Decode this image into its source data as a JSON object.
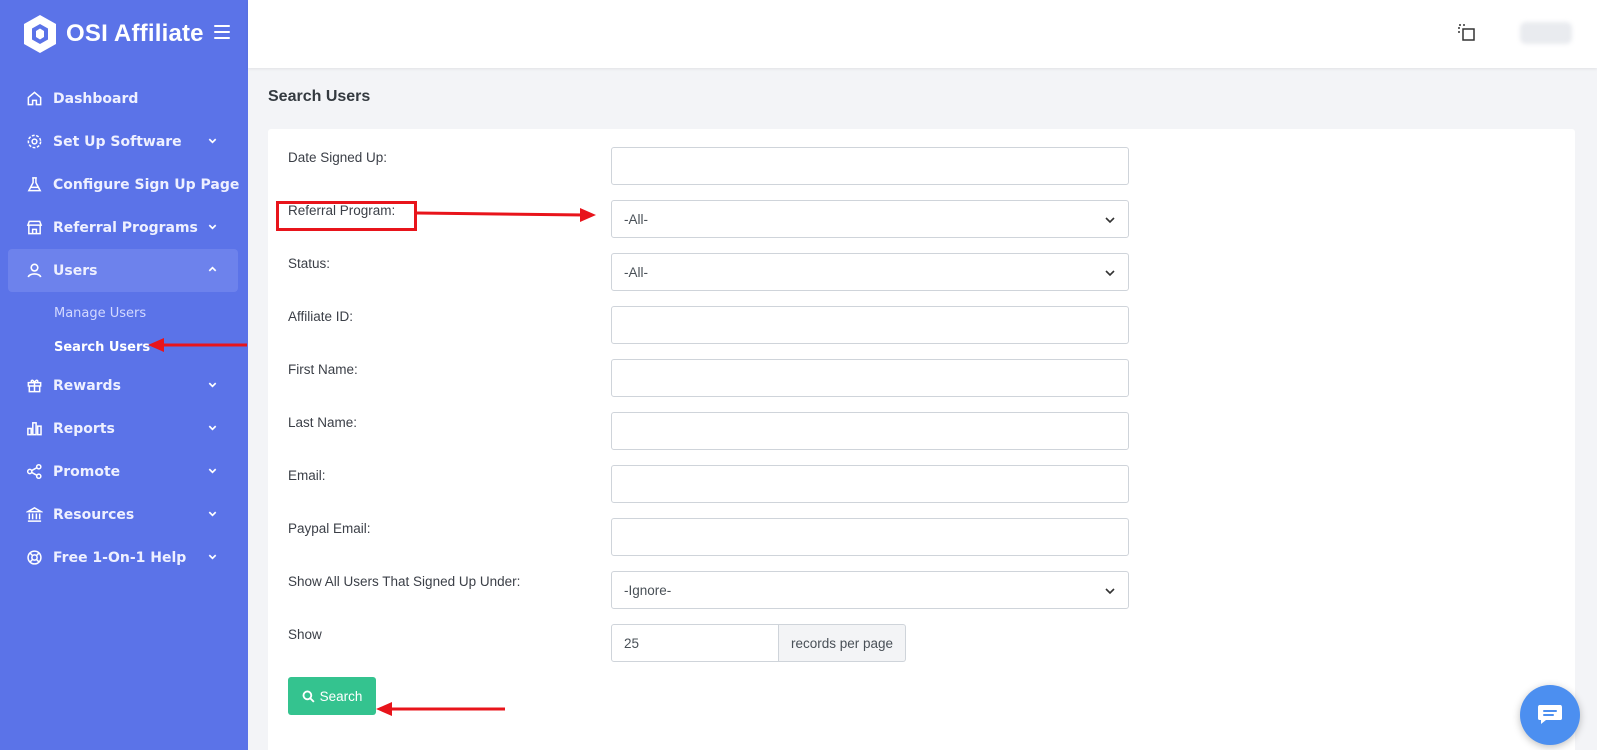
{
  "app": {
    "brand": "OSI Affiliate"
  },
  "sidebar": {
    "items": [
      {
        "label": "Dashboard",
        "icon": "home-icon",
        "has_chevron": false
      },
      {
        "label": "Set Up Software",
        "icon": "gear-icon",
        "has_chevron": true
      },
      {
        "label": "Configure Sign Up Page",
        "icon": "flask-icon",
        "has_chevron": false
      },
      {
        "label": "Referral Programs",
        "icon": "store-icon",
        "has_chevron": true
      },
      {
        "label": "Users",
        "icon": "user-icon",
        "has_chevron": true,
        "expanded": true
      },
      {
        "label": "Rewards",
        "icon": "gift-icon",
        "has_chevron": true
      },
      {
        "label": "Reports",
        "icon": "bar-chart-icon",
        "has_chevron": true
      },
      {
        "label": "Promote",
        "icon": "share-icon",
        "has_chevron": true
      },
      {
        "label": "Resources",
        "icon": "bank-icon",
        "has_chevron": true
      },
      {
        "label": "Free 1-On-1 Help",
        "icon": "lifebuoy-icon",
        "has_chevron": true
      }
    ],
    "users_sub": [
      {
        "label": "Manage Users"
      },
      {
        "label": "Search Users",
        "current": true
      }
    ]
  },
  "page": {
    "title": "Search Users"
  },
  "form": {
    "date_signed_up": {
      "label": "Date Signed Up:",
      "value": ""
    },
    "referral_program": {
      "label": "Referral Program:",
      "value": "-All-"
    },
    "status": {
      "label": "Status:",
      "value": "-All-"
    },
    "affiliate_id": {
      "label": "Affiliate ID:",
      "value": ""
    },
    "first_name": {
      "label": "First Name:",
      "value": ""
    },
    "last_name": {
      "label": "Last Name:",
      "value": ""
    },
    "email": {
      "label": "Email:",
      "value": ""
    },
    "paypal_email": {
      "label": "Paypal Email:",
      "value": ""
    },
    "signed_up_under": {
      "label": "Show All Users That Signed Up Under:",
      "value": "-Ignore-"
    },
    "show": {
      "label": "Show",
      "value": "25",
      "addon": "records per page"
    },
    "search_button": "Search"
  },
  "colors": {
    "sidebar_bg": "#5b73e8",
    "primary_button": "#34c38f",
    "annotation_red": "#e8141b",
    "chat_bubble": "#4c8ff0"
  }
}
